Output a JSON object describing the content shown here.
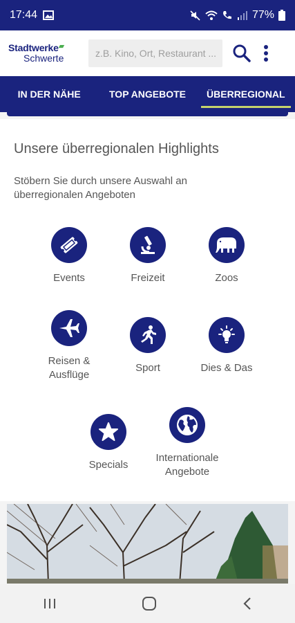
{
  "status_bar": {
    "time": "17:44",
    "battery": "77%"
  },
  "header": {
    "logo_line1": "Stadtwerke",
    "logo_line2": "Schwerte",
    "search_placeholder": "z.B. Kino, Ort, Restaurant ..."
  },
  "tabs": [
    {
      "label": "IN DER NÄHE",
      "active": false
    },
    {
      "label": "TOP ANGEBOTE",
      "active": false
    },
    {
      "label": "ÜBERREGIONAL",
      "active": true
    }
  ],
  "main": {
    "title": "Unsere überregionalen Highlights",
    "subtitle": "Stöbern Sie durch unsere Auswahl an überregionalen Angeboten",
    "categories": [
      {
        "label": "Events",
        "icon": "ticket-icon"
      },
      {
        "label": "Freizeit",
        "icon": "microscope-icon"
      },
      {
        "label": "Zoos",
        "icon": "elephant-icon"
      },
      {
        "label": "Reisen & Ausflüge",
        "icon": "airplane-icon"
      },
      {
        "label": "Sport",
        "icon": "runner-icon"
      },
      {
        "label": "Dies & Das",
        "icon": "lightbulb-icon"
      },
      {
        "label": "Specials",
        "icon": "star-icon"
      },
      {
        "label": "Internationale Angebote",
        "icon": "globe-icon"
      }
    ]
  },
  "colors": {
    "primary": "#1a237e",
    "accent": "#c6d36b",
    "logo_green": "#4caf50"
  }
}
